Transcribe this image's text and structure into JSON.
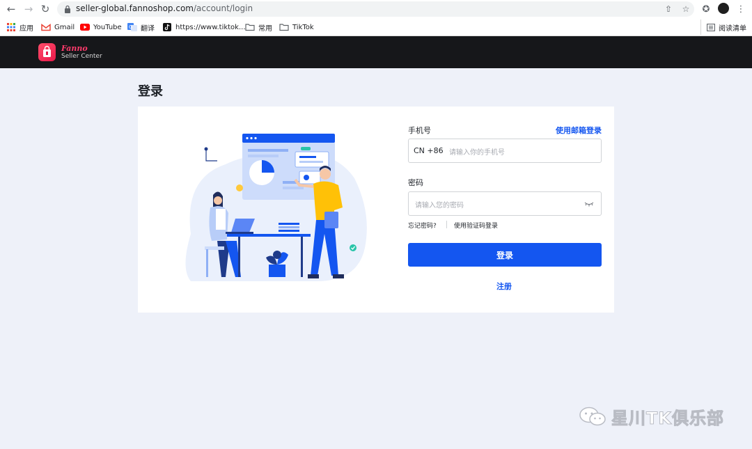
{
  "browser": {
    "url_host": "seller-global.fannoshop.com",
    "url_path": "/account/login",
    "bookmarks": [
      "应用",
      "Gmail",
      "YouTube",
      "翻译",
      "https://www.tiktok...",
      "常用",
      "TikTok"
    ],
    "reading_list": "阅读清单"
  },
  "header": {
    "brand": "Fanno",
    "subtitle": "Seller Center"
  },
  "page": {
    "title": "登录"
  },
  "form": {
    "phone_label": "手机号",
    "email_login_link": "使用邮箱登录",
    "country_code": "CN +86",
    "phone_placeholder": "请输入你的手机号",
    "password_label": "密码",
    "password_placeholder": "请输入您的密码",
    "forgot_password": "忘记密码?",
    "code_login": "使用验证码登录",
    "submit": "登录",
    "register": "注册"
  },
  "watermark": "星川TK俱乐部",
  "colors": {
    "primary": "#1456f0",
    "header_bg": "#16171a",
    "page_bg": "#eef1f9",
    "brand": "#ff3b6c"
  }
}
